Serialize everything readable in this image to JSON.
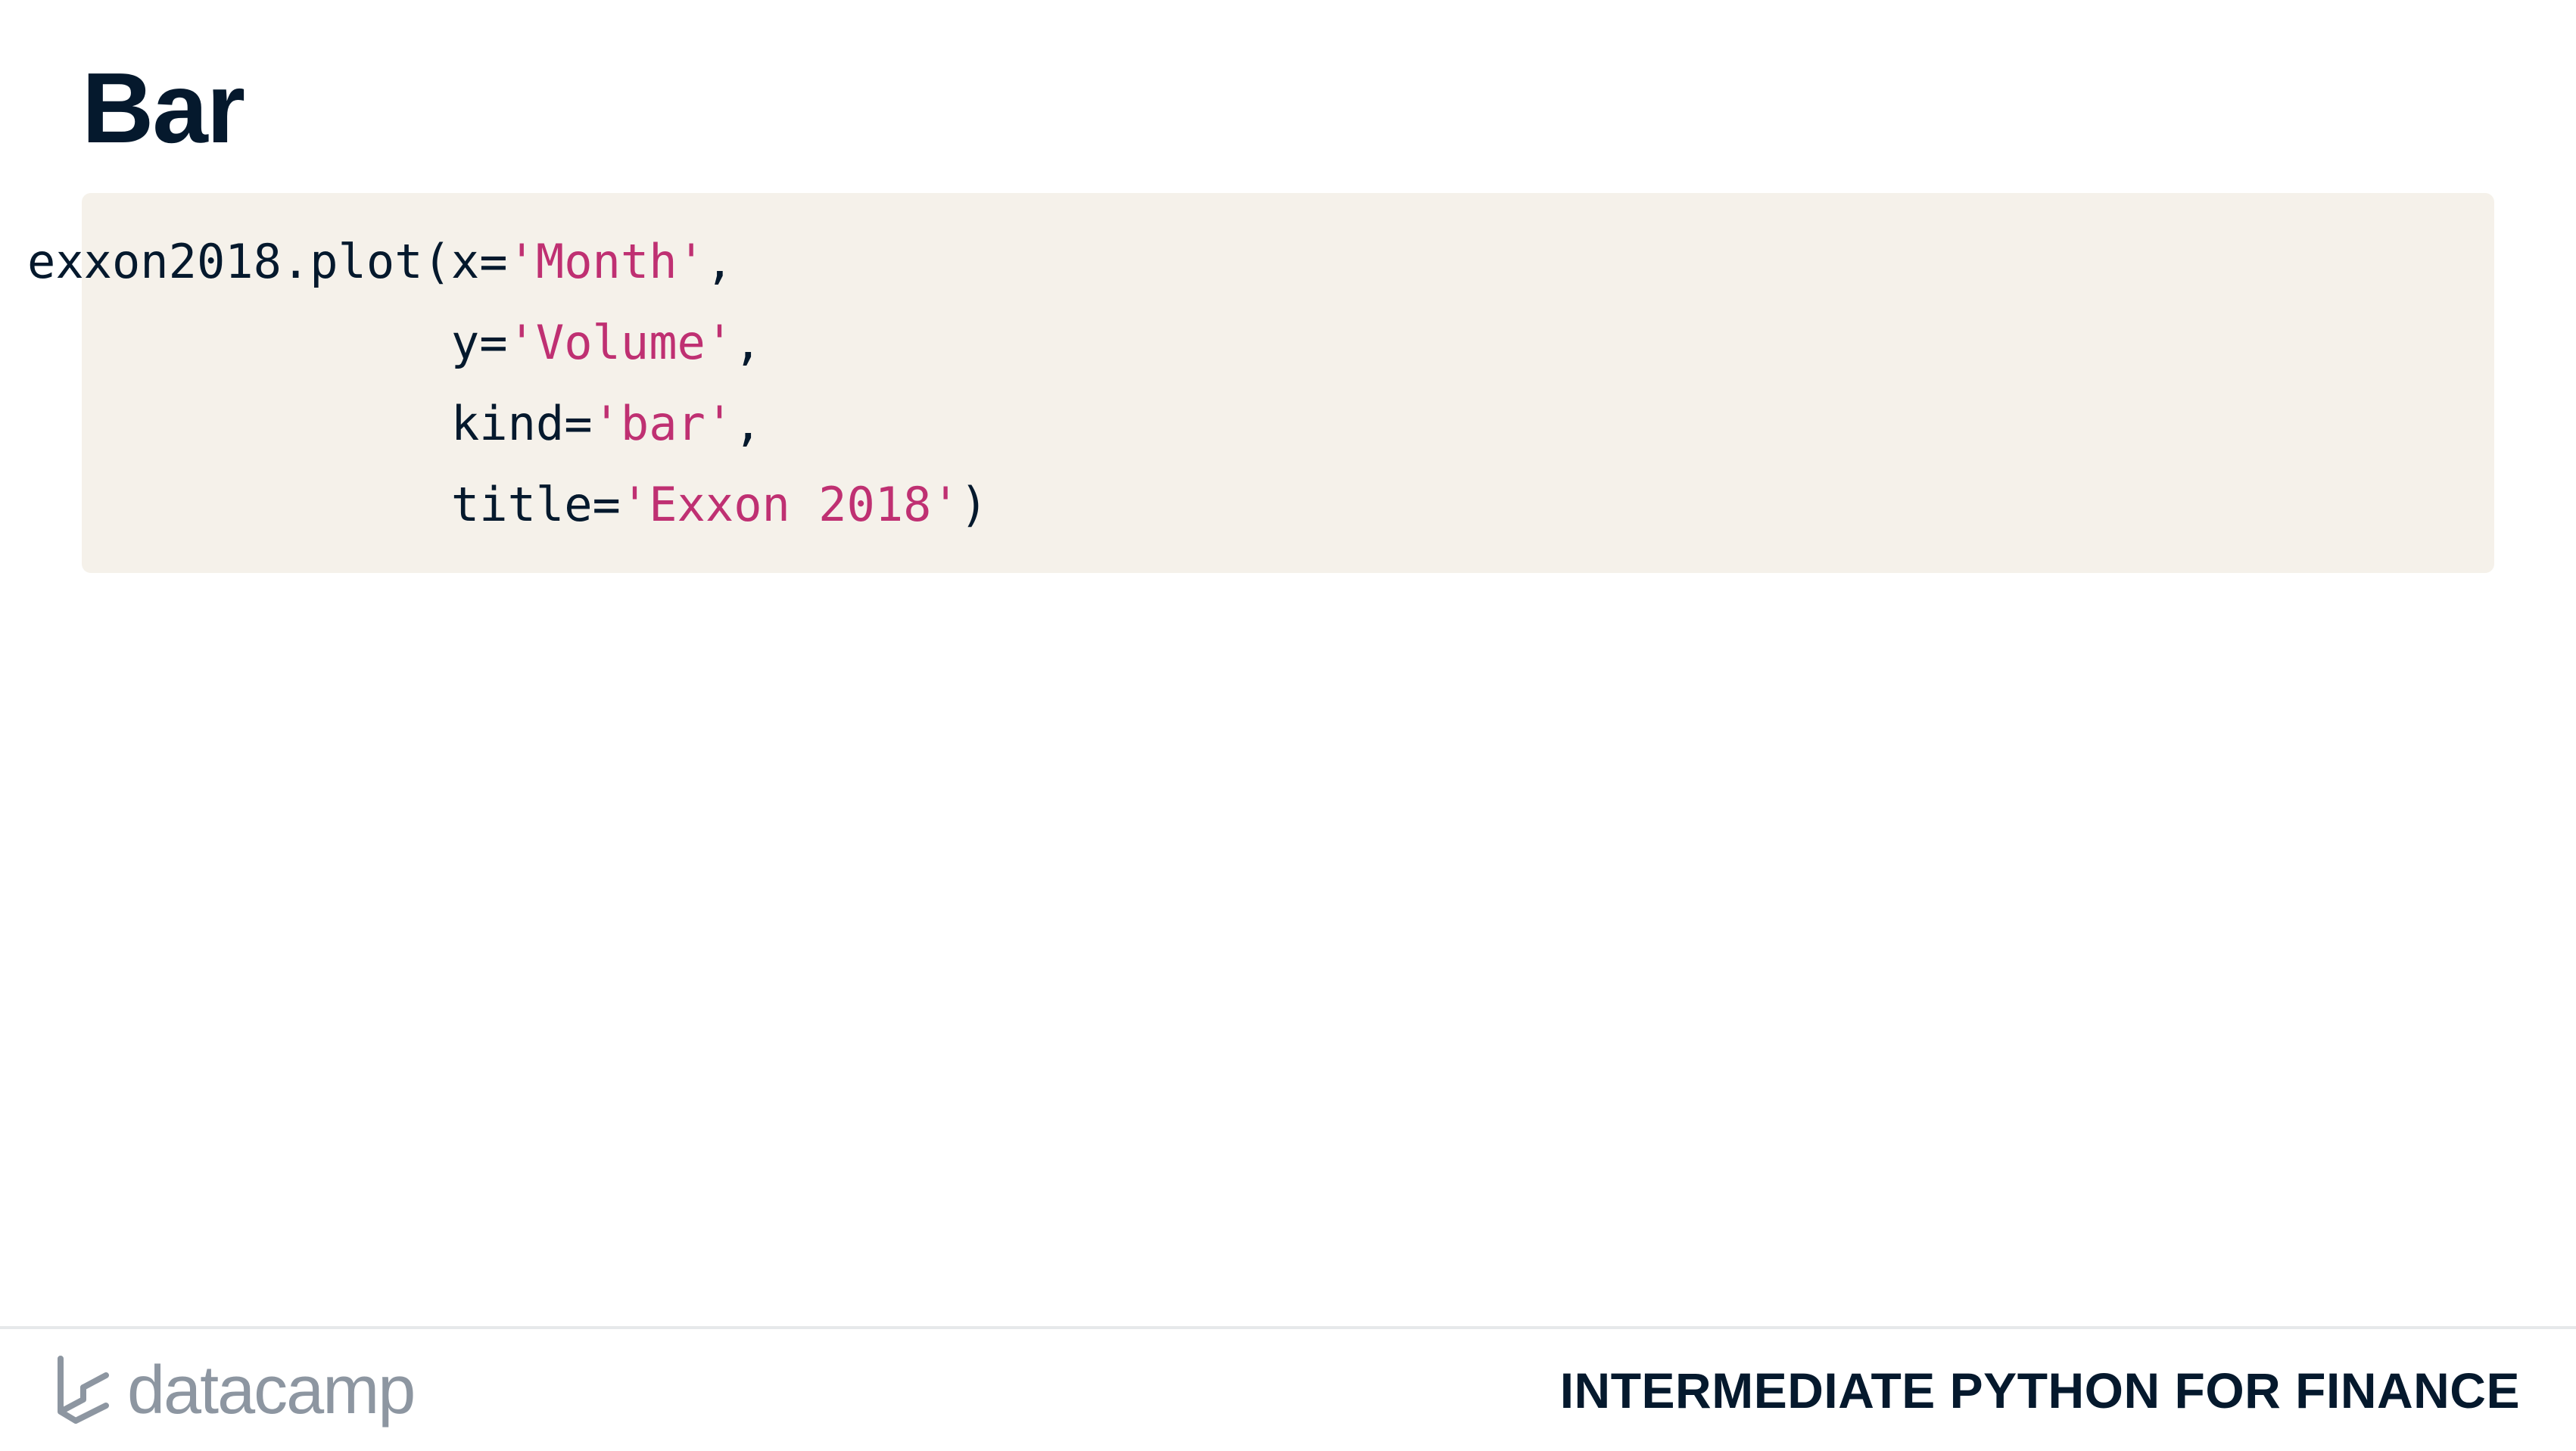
{
  "slide": {
    "title": "Bar"
  },
  "code": {
    "line1": {
      "prefix": "exxon2018.plot(x=",
      "string": "'Month'",
      "suffix": ","
    },
    "line2": {
      "indent": "               ",
      "prefix": "y=",
      "string": "'Volume'",
      "suffix": ","
    },
    "line3": {
      "indent": "               ",
      "prefix": "kind=",
      "string": "'bar'",
      "suffix": ","
    },
    "line4": {
      "indent": "               ",
      "prefix": "title=",
      "string": "'Exxon 2018'",
      "suffix": ")"
    }
  },
  "footer": {
    "brand": "datacamp",
    "course_title": "INTERMEDIATE PYTHON FOR FINANCE"
  },
  "colors": {
    "text_dark": "#05192d",
    "code_background": "#f5f1ea",
    "code_string": "#bf3072",
    "brand_gray": "#8d96a1"
  },
  "icons": {
    "logo": "datacamp-logo-icon"
  }
}
